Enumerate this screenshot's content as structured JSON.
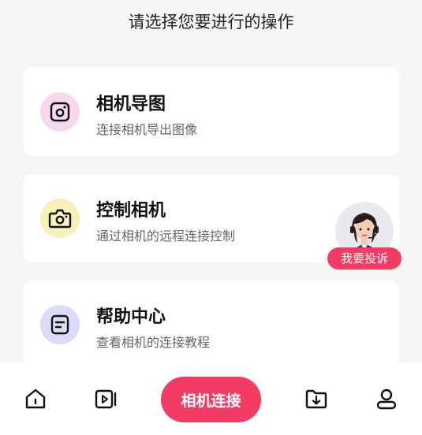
{
  "header": {
    "prompt": "请选择您要进行的操作"
  },
  "cards": [
    {
      "title": "相机导图",
      "subtitle": "连接相机导出图像",
      "icon": "photo-frame-icon",
      "icon_bg": "#f6d9ef"
    },
    {
      "title": "控制相机",
      "subtitle": "通过相机的远程连接控制",
      "icon": "camera-icon",
      "icon_bg": "#f7f0b8"
    },
    {
      "title": "帮助中心",
      "subtitle": "查看相机的连接教程",
      "icon": "document-icon",
      "icon_bg": "#dcdcf8"
    }
  ],
  "support": {
    "label": "我要投诉",
    "icon": "customer-service-avatar"
  },
  "tabbar": {
    "connect_label": "相机连接",
    "tabs": [
      "home-icon",
      "video-icon",
      "folder-download-icon",
      "profile-icon"
    ]
  },
  "colors": {
    "accent": "#f23c64",
    "background": "#f6f6f7"
  }
}
